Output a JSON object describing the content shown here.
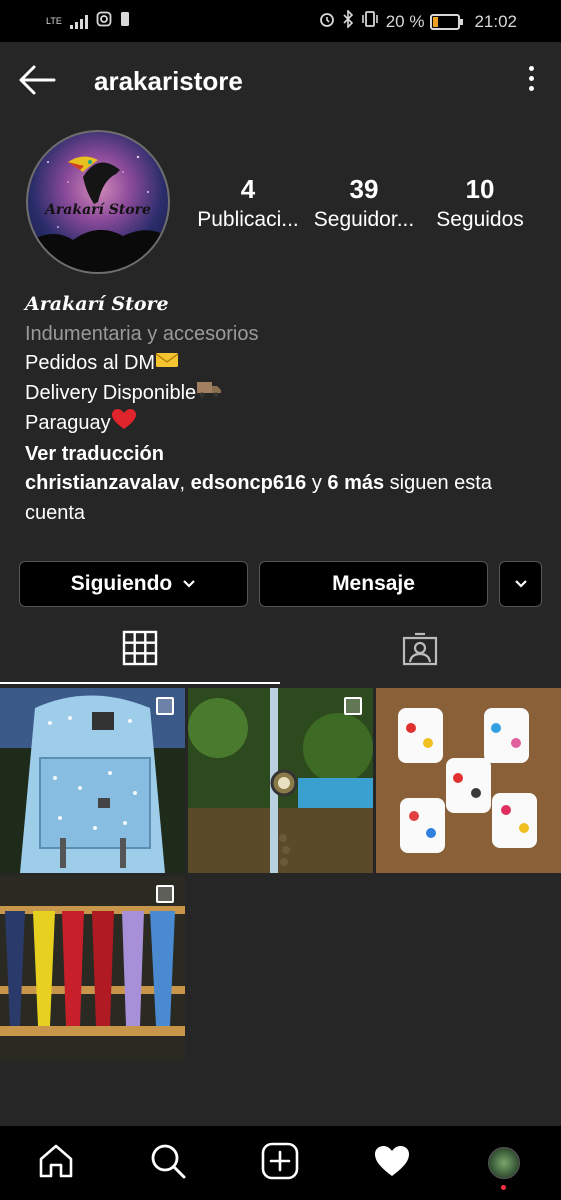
{
  "status_bar": {
    "network": "LTE",
    "battery_percent": "20 %",
    "time": "21:02"
  },
  "header": {
    "username": "arakaristore"
  },
  "profile": {
    "avatar_text": "Arakarí Store",
    "stats": [
      {
        "value": "4",
        "label": "Publicaci..."
      },
      {
        "value": "39",
        "label": "Seguidor..."
      },
      {
        "value": "10",
        "label": "Seguidos"
      }
    ],
    "bio": {
      "name": "Arakarí Store",
      "category": "Indumentaria y accesorios",
      "line1": "Pedidos al DM",
      "line2": "Delivery Disponible",
      "line3": "Paraguay",
      "translate": "Ver traducción",
      "followers_user1": "christianzavalav",
      "sep": ", ",
      "followers_user2": "edsoncp616",
      "and": " y ",
      "more": "6 más",
      "follow_text": " siguen esta cuenta"
    }
  },
  "actions": {
    "following_label": "Siguiendo",
    "message_label": "Mensaje"
  },
  "tabs": {
    "grid_icon": "grid-icon",
    "tagged_icon": "tagged-person-icon"
  },
  "posts": [
    {
      "icon": "multi-photo-icon",
      "subject": "backpack"
    },
    {
      "icon": "multi-photo-icon",
      "subject": "watch"
    },
    {
      "icon": "none",
      "subject": "pins"
    },
    {
      "icon": "multi-photo-icon",
      "subject": "bandanas"
    }
  ],
  "bottom_nav": [
    "home-icon",
    "search-icon",
    "add-icon",
    "heart-icon",
    "profile-avatar"
  ],
  "colors": {
    "background": "#262626",
    "status_bar": "#000000",
    "border": "#555555",
    "muted_text": "#9a9a9a",
    "notification_dot": "#ff3040"
  }
}
